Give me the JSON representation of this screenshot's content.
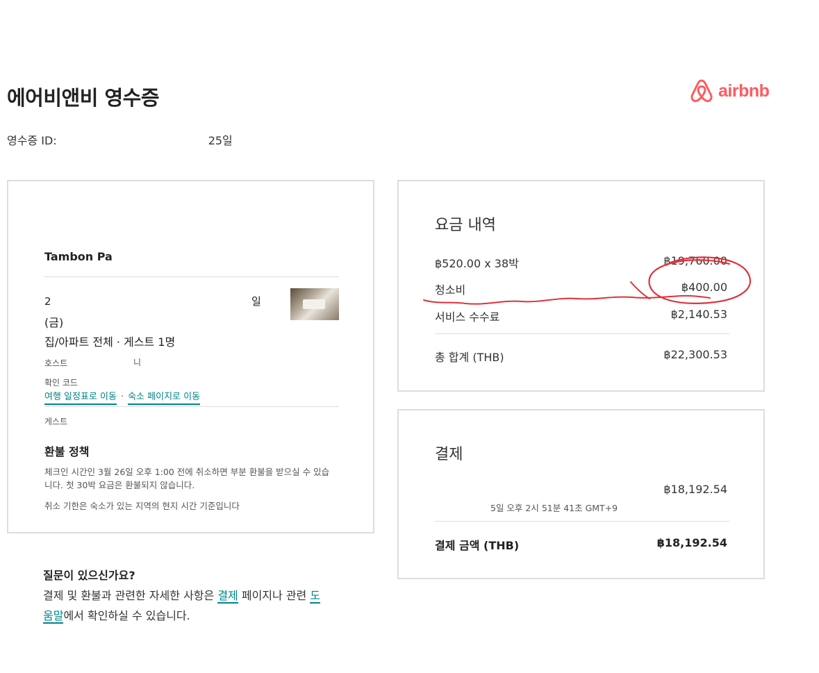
{
  "header": {
    "title": "에어비앤비 영수증",
    "receipt_id_label": "영수증 ID:",
    "receipt_id_tail": "25일",
    "logo_text": "airbnb",
    "brand_color": "#FF5A5F"
  },
  "stay": {
    "name": "Tambon Pa",
    "date_line": "2",
    "date_tail": "일",
    "day": "(금)",
    "type": "집/아파트 전체 · 게스트 1명",
    "host_label": "호스트",
    "host_tail": "니",
    "code_label": "확인 코드",
    "link_itinerary": "여행 일정표로 이동",
    "link_separator": "·",
    "link_listing": "숙소 페이지로 이동",
    "guest_label": "게스트",
    "policy_title": "환불 정책",
    "policy_text": "체크인 시간인 3월 26일 오후 1:00 전에 취소하면 부분 환불을 받으실 수 있습니다. 첫 30박 요금은 환불되지 않습니다.",
    "policy_note": "취소 기한은 숙소가 있는 지역의 현지 시간 기준입니다"
  },
  "price": {
    "title": "요금 내역",
    "rows": [
      {
        "label": "฿520.00 x 38박",
        "value": "฿19,760.00"
      },
      {
        "label": "청소비",
        "value": "฿400.00"
      },
      {
        "label": "서비스 수수료",
        "value": "฿2,140.53"
      }
    ],
    "total_label": "총 합계 (THB)",
    "total_value": "฿22,300.53"
  },
  "payment": {
    "title": "결제",
    "amount": "฿18,192.54",
    "timestamp": "5일 오후 2시 51분 41초 GMT+9",
    "total_label": "결제 금액 (THB)",
    "total_value": "฿18,192.54"
  },
  "faq": {
    "title": "질문이 있으신가요?",
    "text_1": "결제 및 환불과 관련한 자세한 사항은 ",
    "link_payment": "결제",
    "text_2": " 페이지나 관련 ",
    "link_help_1": "도",
    "link_help_2": "움말",
    "text_3": "에서 확인하실 수 있습니다."
  },
  "annotation_color": "#E0303A"
}
